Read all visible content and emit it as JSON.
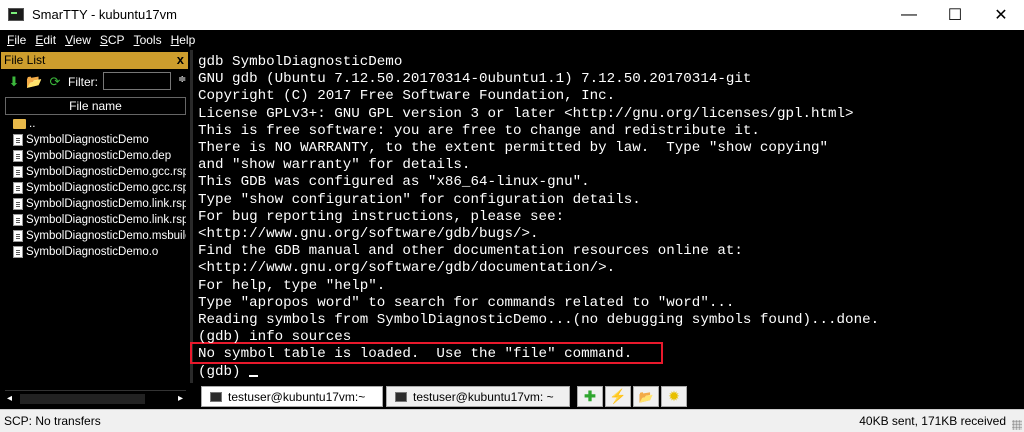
{
  "window": {
    "title": "SmarTTY - kubuntu17vm",
    "min_glyph": "—",
    "max_glyph": "☐",
    "close_glyph": "✕"
  },
  "menu": [
    "File",
    "Edit",
    "View",
    "SCP",
    "Tools",
    "Help"
  ],
  "file_list": {
    "title": "File List",
    "close_glyph": "x",
    "filter_label": "Filter:",
    "filter_value": "",
    "column_header": "File name",
    "rows": [
      {
        "name": "..",
        "icon": "folder-icon"
      },
      {
        "name": "SymbolDiagnosticDemo",
        "icon": "file-icon"
      },
      {
        "name": "SymbolDiagnosticDemo.dep",
        "icon": "file-icon"
      },
      {
        "name": "SymbolDiagnosticDemo.gcc.rsp",
        "icon": "file-icon"
      },
      {
        "name": "SymbolDiagnosticDemo.gcc.rsp",
        "icon": "file-icon"
      },
      {
        "name": "SymbolDiagnosticDemo.link.rsp",
        "icon": "file-icon"
      },
      {
        "name": "SymbolDiagnosticDemo.link.rsp",
        "icon": "file-icon"
      },
      {
        "name": "SymbolDiagnosticDemo.msbuild",
        "icon": "file-icon"
      },
      {
        "name": "SymbolDiagnosticDemo.o",
        "icon": "file-icon"
      }
    ]
  },
  "terminal": {
    "lines": [
      "gdb SymbolDiagnosticDemo",
      "GNU gdb (Ubuntu 7.12.50.20170314-0ubuntu1.1) 7.12.50.20170314-git",
      "Copyright (C) 2017 Free Software Foundation, Inc.",
      "License GPLv3+: GNU GPL version 3 or later <http://gnu.org/licenses/gpl.html>",
      "This is free software: you are free to change and redistribute it.",
      "There is NO WARRANTY, to the extent permitted by law.  Type \"show copying\"",
      "and \"show warranty\" for details.",
      "This GDB was configured as \"x86_64-linux-gnu\".",
      "Type \"show configuration\" for configuration details.",
      "For bug reporting instructions, please see:",
      "<http://www.gnu.org/software/gdb/bugs/>.",
      "Find the GDB manual and other documentation resources online at:",
      "<http://www.gnu.org/software/gdb/documentation/>.",
      "For help, type \"help\".",
      "Type \"apropos word\" to search for commands related to \"word\"...",
      "Reading symbols from SymbolDiagnosticDemo...(no debugging symbols found)...done.",
      "(gdb) info sources",
      "No symbol table is loaded.  Use the \"file\" command.",
      "(gdb)"
    ],
    "highlight_color": "#e8192c"
  },
  "tabs": [
    {
      "label": "testuser@kubuntu17vm:~",
      "active": true
    },
    {
      "label": "testuser@kubuntu17vm: ~",
      "active": false
    }
  ],
  "tab_buttons": [
    {
      "name": "new-tab-icon",
      "glyph": "✚",
      "color": "#2fa62f"
    },
    {
      "name": "lightning-icon",
      "glyph": "⚡",
      "color": "#e0a000"
    },
    {
      "name": "folder-open-icon",
      "glyph": "📂",
      "color": "#d9a93a"
    },
    {
      "name": "sun-icon",
      "glyph": "✹",
      "color": "#e8c000"
    }
  ],
  "status": {
    "left": "SCP: No transfers",
    "right": "40KB sent, 171KB received"
  },
  "colors": {
    "file_list_header": "#cd9d2d",
    "terminal_bg": "#000000",
    "terminal_fg": "#ffffff"
  }
}
